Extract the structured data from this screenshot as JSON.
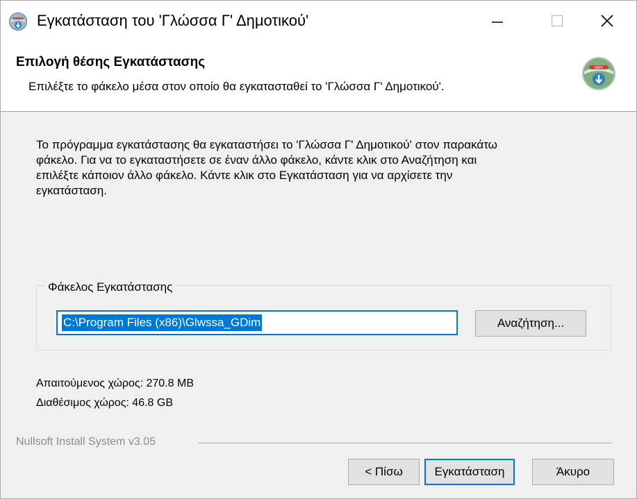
{
  "window": {
    "title": "Εγκατάσταση του 'Γλώσσα Γ' Δημοτικού'"
  },
  "header": {
    "title": "Επιλογή θέσης Εγκατάστασης",
    "subtitle": "Επιλέξτε το φάκελο μέσα στον οποίο θα εγκατασταθεί το 'Γλώσσα Γ' Δημοτικού'."
  },
  "body": {
    "description_lines": [
      "Το πρόγραμμα εγκατάστασης θα εγκαταστήσει το 'Γλώσσα Γ' Δημοτικού' στον παρακάτω",
      "φάκελο. Για να το εγκαταστήσετε σε έναν άλλο φάκελο, κάντε κλικ στο Αναζήτηση και",
      "επιλέξτε κάποιον άλλο φάκελο. Κάντε κλικ στο Εγκατάσταση για να αρχίσετε την",
      "εγκατάσταση."
    ],
    "group_label": "Φάκελος Εγκατάστασης",
    "install_path": "C:\\Program Files (x86)\\Glwssa_GDim",
    "browse_label": "Αναζήτηση...",
    "space_required": "Απαιτούμενος χώρος: 270.8 MB",
    "space_available": "Διαθέσιμος χώρος: 46.8 GB"
  },
  "footer": {
    "branding": "Nullsoft Install System v3.05",
    "back_label": "< Πίσω",
    "install_label": "Εγκατάσταση",
    "cancel_label": "Άκυρο"
  },
  "colors": {
    "accent": "#0078d7",
    "button_face": "#e1e1e1",
    "window_bg": "#f0f0f0"
  }
}
